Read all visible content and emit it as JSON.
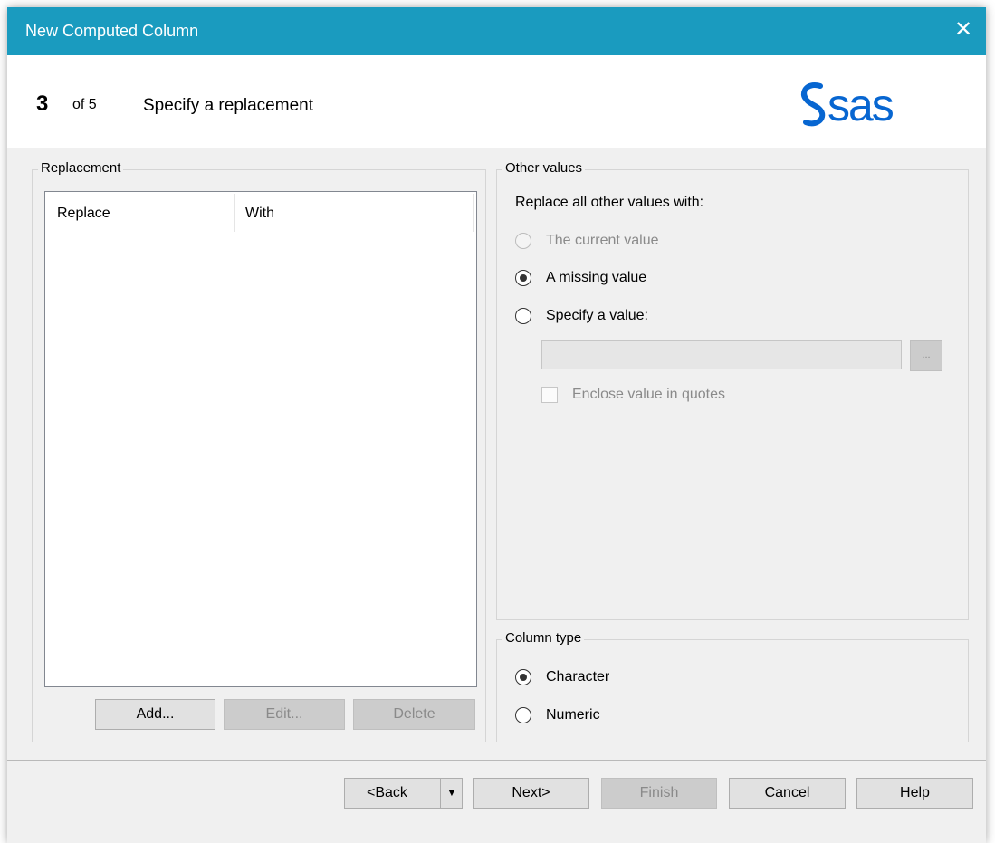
{
  "window": {
    "title": "New Computed Column",
    "close_glyph": "✕"
  },
  "header": {
    "step_current": "3",
    "step_of": "of 5",
    "step_title": "Specify a replacement",
    "logo_text": "sas",
    "logo_icon": "sas-logo"
  },
  "replacement": {
    "group_label": "Replacement",
    "columns": [
      "Replace",
      "With"
    ],
    "rows": [],
    "add_label": "Add...",
    "edit_label": "Edit...",
    "delete_label": "Delete"
  },
  "other_values": {
    "group_label": "Other values",
    "prompt": "Replace all other values with:",
    "options": [
      "The current value",
      "A missing value",
      "Specify a value:"
    ],
    "selected": "A missing value",
    "value_input": "",
    "ellipsis_label": "...",
    "enclose_label": "Enclose value in quotes",
    "enclose_checked": false
  },
  "column_type": {
    "group_label": "Column type",
    "options": [
      "Character",
      "Numeric"
    ],
    "selected": "Character"
  },
  "footer": {
    "back_label": "<Back",
    "back_menu_glyph": "▼",
    "next_label": "Next>",
    "finish_label": "Finish",
    "cancel_label": "Cancel",
    "help_label": "Help"
  },
  "colors": {
    "titlebar": "#1a9bbf",
    "dialog_bg": "#f0f0f0",
    "logo_blue": "#0766d1",
    "disabled_text": "#8a8a8a"
  }
}
